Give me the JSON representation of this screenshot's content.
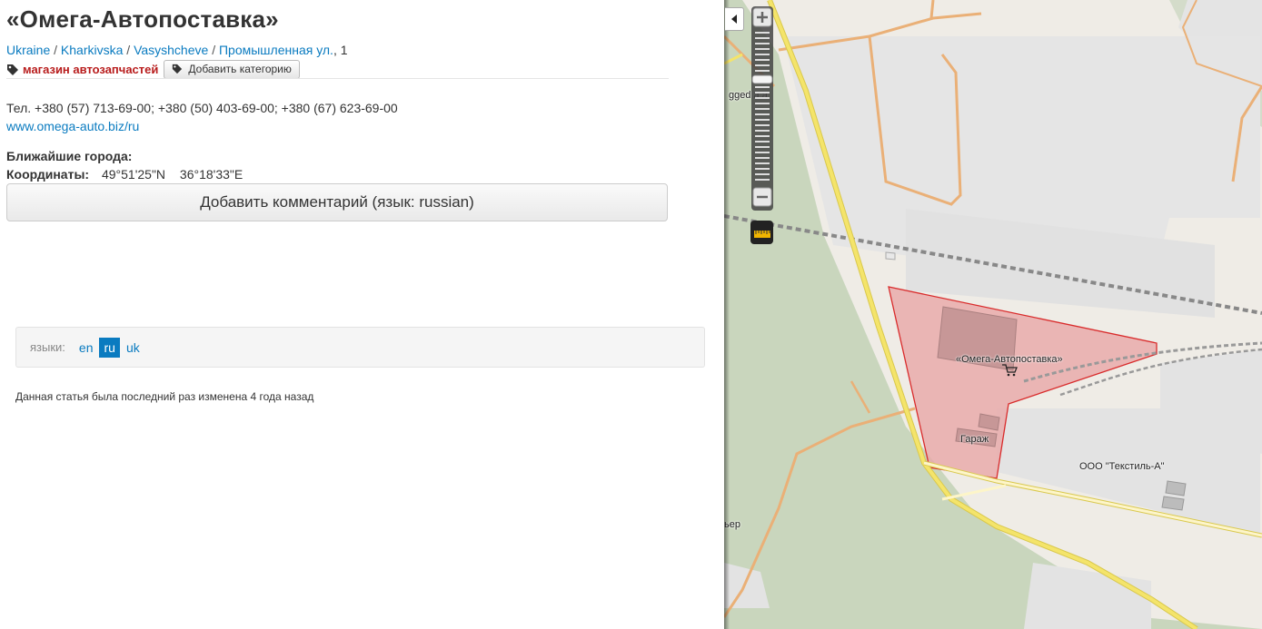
{
  "page": {
    "title": "«Омега-Автопоставка»",
    "breadcrumb": [
      {
        "label": "Ukraine"
      },
      {
        "label": "Kharkivska"
      },
      {
        "label": "Vasyshcheve"
      },
      {
        "label": "Промышленная ул."
      }
    ],
    "house_number": "1",
    "separator": "/",
    "category": "магазин автозапчастей",
    "add_category_label": "Добавить категорию",
    "phone_text": "Тел. +380 (57) 713-69-00; +380 (50) 403-69-00; +380 (67) 623-69-00",
    "website": "www.omega-auto.biz/ru",
    "nearest_label": "Ближайшие города:",
    "coords_label": "Координаты:",
    "latitude": "49°51'25\"N",
    "longitude": "36°18'33\"E",
    "add_comment_label": "Добавить комментарий (язык: russian)"
  },
  "languages": {
    "label": "языки:",
    "items": [
      {
        "code": "en",
        "active": false
      },
      {
        "code": "ru",
        "active": true
      },
      {
        "code": "uk",
        "active": false
      }
    ]
  },
  "footer": {
    "modified": "Данная статья была последний раз изменена 4 года назад"
  },
  "map": {
    "labels": {
      "main_poi": "«Омега-Автопоставка»",
      "garage": "Гараж",
      "textile": "ООО \"Текстиль-А\"",
      "partial_top": "gged a a",
      "partial_bottom": "ьер"
    },
    "colors": {
      "background": "#efece6",
      "green_area": "#c9d6bd",
      "industrial": "#e2e2e2",
      "highlight_fill": "#e8a7a8",
      "highlight_stroke": "#d92b2b",
      "road_major": "#f4e46a",
      "road_minor": "#eab077"
    }
  },
  "icons": {
    "tag": "tag-icon",
    "zoom_in": "plus-icon",
    "zoom_out": "minus-icon",
    "ruler": "ruler-icon",
    "collapse": "triangle-left-icon",
    "shop": "shopping-cart-icon"
  }
}
